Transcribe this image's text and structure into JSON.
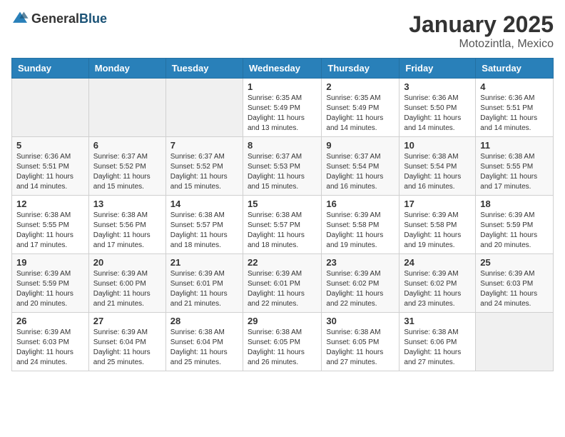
{
  "logo": {
    "text_general": "General",
    "text_blue": "Blue"
  },
  "title": "January 2025",
  "location": "Motozintla, Mexico",
  "days_of_week": [
    "Sunday",
    "Monday",
    "Tuesday",
    "Wednesday",
    "Thursday",
    "Friday",
    "Saturday"
  ],
  "weeks": [
    [
      {
        "day": "",
        "info": ""
      },
      {
        "day": "",
        "info": ""
      },
      {
        "day": "",
        "info": ""
      },
      {
        "day": "1",
        "info": "Sunrise: 6:35 AM\nSunset: 5:49 PM\nDaylight: 11 hours\nand 13 minutes."
      },
      {
        "day": "2",
        "info": "Sunrise: 6:35 AM\nSunset: 5:49 PM\nDaylight: 11 hours\nand 14 minutes."
      },
      {
        "day": "3",
        "info": "Sunrise: 6:36 AM\nSunset: 5:50 PM\nDaylight: 11 hours\nand 14 minutes."
      },
      {
        "day": "4",
        "info": "Sunrise: 6:36 AM\nSunset: 5:51 PM\nDaylight: 11 hours\nand 14 minutes."
      }
    ],
    [
      {
        "day": "5",
        "info": "Sunrise: 6:36 AM\nSunset: 5:51 PM\nDaylight: 11 hours\nand 14 minutes."
      },
      {
        "day": "6",
        "info": "Sunrise: 6:37 AM\nSunset: 5:52 PM\nDaylight: 11 hours\nand 15 minutes."
      },
      {
        "day": "7",
        "info": "Sunrise: 6:37 AM\nSunset: 5:52 PM\nDaylight: 11 hours\nand 15 minutes."
      },
      {
        "day": "8",
        "info": "Sunrise: 6:37 AM\nSunset: 5:53 PM\nDaylight: 11 hours\nand 15 minutes."
      },
      {
        "day": "9",
        "info": "Sunrise: 6:37 AM\nSunset: 5:54 PM\nDaylight: 11 hours\nand 16 minutes."
      },
      {
        "day": "10",
        "info": "Sunrise: 6:38 AM\nSunset: 5:54 PM\nDaylight: 11 hours\nand 16 minutes."
      },
      {
        "day": "11",
        "info": "Sunrise: 6:38 AM\nSunset: 5:55 PM\nDaylight: 11 hours\nand 17 minutes."
      }
    ],
    [
      {
        "day": "12",
        "info": "Sunrise: 6:38 AM\nSunset: 5:55 PM\nDaylight: 11 hours\nand 17 minutes."
      },
      {
        "day": "13",
        "info": "Sunrise: 6:38 AM\nSunset: 5:56 PM\nDaylight: 11 hours\nand 17 minutes."
      },
      {
        "day": "14",
        "info": "Sunrise: 6:38 AM\nSunset: 5:57 PM\nDaylight: 11 hours\nand 18 minutes."
      },
      {
        "day": "15",
        "info": "Sunrise: 6:38 AM\nSunset: 5:57 PM\nDaylight: 11 hours\nand 18 minutes."
      },
      {
        "day": "16",
        "info": "Sunrise: 6:39 AM\nSunset: 5:58 PM\nDaylight: 11 hours\nand 19 minutes."
      },
      {
        "day": "17",
        "info": "Sunrise: 6:39 AM\nSunset: 5:58 PM\nDaylight: 11 hours\nand 19 minutes."
      },
      {
        "day": "18",
        "info": "Sunrise: 6:39 AM\nSunset: 5:59 PM\nDaylight: 11 hours\nand 20 minutes."
      }
    ],
    [
      {
        "day": "19",
        "info": "Sunrise: 6:39 AM\nSunset: 5:59 PM\nDaylight: 11 hours\nand 20 minutes."
      },
      {
        "day": "20",
        "info": "Sunrise: 6:39 AM\nSunset: 6:00 PM\nDaylight: 11 hours\nand 21 minutes."
      },
      {
        "day": "21",
        "info": "Sunrise: 6:39 AM\nSunset: 6:01 PM\nDaylight: 11 hours\nand 21 minutes."
      },
      {
        "day": "22",
        "info": "Sunrise: 6:39 AM\nSunset: 6:01 PM\nDaylight: 11 hours\nand 22 minutes."
      },
      {
        "day": "23",
        "info": "Sunrise: 6:39 AM\nSunset: 6:02 PM\nDaylight: 11 hours\nand 22 minutes."
      },
      {
        "day": "24",
        "info": "Sunrise: 6:39 AM\nSunset: 6:02 PM\nDaylight: 11 hours\nand 23 minutes."
      },
      {
        "day": "25",
        "info": "Sunrise: 6:39 AM\nSunset: 6:03 PM\nDaylight: 11 hours\nand 24 minutes."
      }
    ],
    [
      {
        "day": "26",
        "info": "Sunrise: 6:39 AM\nSunset: 6:03 PM\nDaylight: 11 hours\nand 24 minutes."
      },
      {
        "day": "27",
        "info": "Sunrise: 6:39 AM\nSunset: 6:04 PM\nDaylight: 11 hours\nand 25 minutes."
      },
      {
        "day": "28",
        "info": "Sunrise: 6:38 AM\nSunset: 6:04 PM\nDaylight: 11 hours\nand 25 minutes."
      },
      {
        "day": "29",
        "info": "Sunrise: 6:38 AM\nSunset: 6:05 PM\nDaylight: 11 hours\nand 26 minutes."
      },
      {
        "day": "30",
        "info": "Sunrise: 6:38 AM\nSunset: 6:05 PM\nDaylight: 11 hours\nand 27 minutes."
      },
      {
        "day": "31",
        "info": "Sunrise: 6:38 AM\nSunset: 6:06 PM\nDaylight: 11 hours\nand 27 minutes."
      },
      {
        "day": "",
        "info": ""
      }
    ]
  ]
}
